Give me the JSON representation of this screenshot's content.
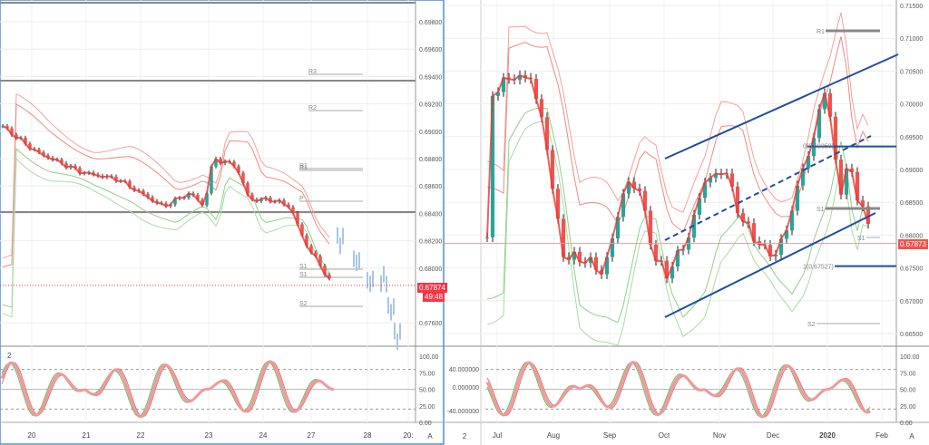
{
  "left_chart": {
    "price_ticks": [
      "0.69800",
      "0.69600",
      "0.69400",
      "0.69200",
      "0.69000",
      "0.68800",
      "0.68600",
      "0.68400",
      "0.68200",
      "0.68000",
      "0.67600"
    ],
    "last_price": "0.67874",
    "countdown": "49:48",
    "pivot_labels": [
      "R3",
      "R2",
      "R1",
      "R1",
      "P",
      "S1",
      "S1",
      "S2"
    ],
    "x_labels": [
      "20",
      "21",
      "22",
      "23",
      "24",
      "27",
      "28",
      "20:"
    ],
    "osc_label": "2",
    "osc_ticks": [
      "100.00",
      "75.00",
      "50.00",
      "25.00",
      "0.00"
    ],
    "auto_label": "A"
  },
  "right_chart": {
    "price_ticks": [
      "0.71500",
      "0.71000",
      "0.70500",
      "0.70000",
      "0.69500",
      "0.69000",
      "0.68500",
      "0.68000",
      "0.67500",
      "0.67000",
      "0.66500"
    ],
    "last_price": "0.67873",
    "fib_labels": [
      "0(0.69350)",
      "1(0.67527)"
    ],
    "pivot_labels": [
      "R1",
      "S1",
      "S1",
      "S2"
    ],
    "x_labels": [
      "Jul",
      "Aug",
      "Sep",
      "Oct",
      "Nov",
      "Dec",
      "2020",
      "Feb"
    ],
    "osc_label": "2",
    "osc_left_ticks": [
      "40.000000",
      "0.000000",
      "-40.000000"
    ],
    "osc_ticks": [
      "100.00",
      "75.00",
      "50.00",
      "25.00",
      "0.00"
    ],
    "auto_label": "A"
  },
  "chart_data": [
    {
      "type": "candlestick",
      "name": "left-hourly",
      "ylim": [
        0.6745,
        0.6995
      ],
      "keypoints": [
        [
          0,
          0.6905
        ],
        [
          40,
          0.6885
        ],
        [
          90,
          0.687
        ],
        [
          130,
          0.6865
        ],
        [
          180,
          0.6845
        ],
        [
          210,
          0.6855
        ],
        [
          225,
          0.6845
        ],
        [
          235,
          0.688
        ],
        [
          260,
          0.6875
        ],
        [
          275,
          0.685
        ],
        [
          300,
          0.685
        ],
        [
          320,
          0.6845
        ],
        [
          335,
          0.682
        ],
        [
          355,
          0.68
        ],
        [
          367,
          0.6787
        ]
      ],
      "projection": [
        [
          372,
          0.682
        ],
        [
          390,
          0.6805
        ],
        [
          405,
          0.679
        ],
        [
          420,
          0.6792
        ],
        [
          428,
          0.677
        ],
        [
          435,
          0.675
        ]
      ]
    },
    {
      "type": "candlestick",
      "name": "right-daily",
      "ylim": [
        0.6635,
        0.7155
      ],
      "keypoints": [
        [
          540,
          0.701
        ],
        [
          560,
          0.704
        ],
        [
          585,
          0.704
        ],
        [
          600,
          0.696
        ],
        [
          620,
          0.677
        ],
        [
          650,
          0.676
        ],
        [
          665,
          0.674
        ],
        [
          690,
          0.688
        ],
        [
          705,
          0.687
        ],
        [
          720,
          0.677
        ],
        [
          735,
          0.674
        ],
        [
          760,
          0.68
        ],
        [
          775,
          0.688
        ],
        [
          800,
          0.69
        ],
        [
          815,
          0.683
        ],
        [
          840,
          0.678
        ],
        [
          855,
          0.677
        ],
        [
          870,
          0.682
        ],
        [
          880,
          0.688
        ],
        [
          900,
          0.696
        ],
        [
          908,
          0.703
        ],
        [
          915,
          0.698
        ],
        [
          925,
          0.686
        ],
        [
          935,
          0.691
        ],
        [
          945,
          0.686
        ],
        [
          955,
          0.683
        ],
        [
          960,
          0.6788
        ]
      ]
    }
  ]
}
